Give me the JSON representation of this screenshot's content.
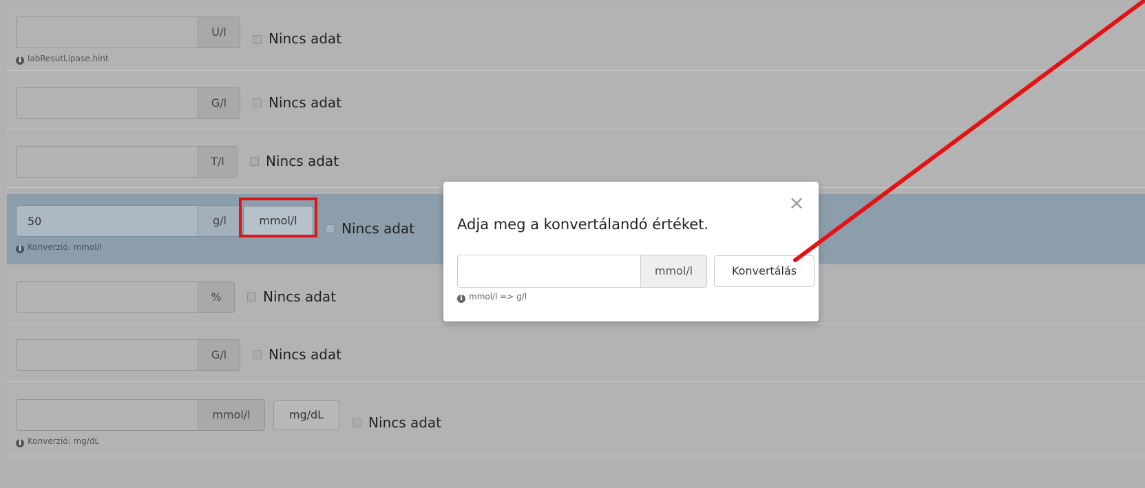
{
  "rows": [
    {
      "value": "",
      "unit": "U/l",
      "nodata": "Nincs adat",
      "hint": "labResutLipase.hint"
    },
    {
      "value": "",
      "unit": "G/l",
      "nodata": "Nincs adat"
    },
    {
      "value": "",
      "unit": "T/l",
      "nodata": "Nincs adat"
    },
    {
      "value": "50",
      "unit": "g/l",
      "convert_label": "mmol/l",
      "nodata": "Nincs adat",
      "hint": "Konverzió: mmol/l"
    },
    {
      "value": "",
      "unit": "%",
      "nodata": "Nincs adat"
    },
    {
      "value": "",
      "unit": "G/l",
      "nodata": "Nincs adat"
    },
    {
      "value": "",
      "unit": "mmol/l",
      "convert_label": "mg/dL",
      "nodata": "Nincs adat",
      "hint": "Konverzió: mg/dL"
    }
  ],
  "modal": {
    "title": "Adja meg a konvertálandó értéket.",
    "close_symbol": "×",
    "input_value": "",
    "unit": "mmol/l",
    "button_label": "Konvertálás",
    "hint": "mmol/l => g/l"
  },
  "annotation": {
    "highlight_color": "#e31313",
    "arrow_color": "#e31313"
  },
  "info_icon_glyph": "i"
}
